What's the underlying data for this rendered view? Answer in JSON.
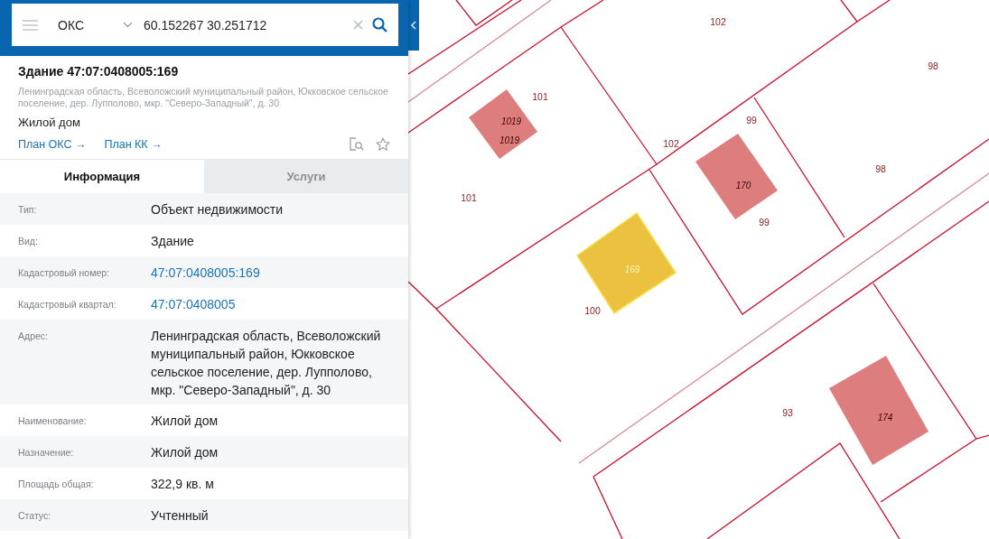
{
  "search": {
    "category": "ОКС",
    "query": "60.152267 30.251712"
  },
  "object": {
    "title": "Здание 47:07:0408005:169",
    "address": "Ленинградская область, Всеволожский муниципальный район, Юкковское сельское поселение, дер. Лупполово, мкр. \"Северо-Западный\", д. 30",
    "purpose": "Жилой дом",
    "links": [
      "План ОКС →",
      "План КК →"
    ]
  },
  "tabs": [
    {
      "label": "Информация",
      "selected": true
    },
    {
      "label": "Услуги",
      "selected": false
    }
  ],
  "fields": [
    {
      "label": "Тип:",
      "value": "Объект недвижимости",
      "kind": "text"
    },
    {
      "label": "Вид:",
      "value": "Здание",
      "kind": "text"
    },
    {
      "label": "Кадастровый номер:",
      "value": "47:07:0408005:169",
      "kind": "link"
    },
    {
      "label": "Кадастровый квартал:",
      "value": "47:07:0408005",
      "kind": "link"
    },
    {
      "label": "Адрес:",
      "value": "Ленинградская область, Всеволожский муниципальный район, Юкковское сельское поселение, дер. Лупполово, мкр. \"Северо-Западный\", д. 30",
      "kind": "text"
    },
    {
      "label": "Наименование:",
      "value": "Жилой дом",
      "kind": "text"
    },
    {
      "label": "Назначение:",
      "value": "Жилой дом",
      "kind": "text"
    },
    {
      "label": "Площадь общая:",
      "value": "322,9 кв. м",
      "kind": "text"
    },
    {
      "label": "Статус:",
      "value": "Учтенный",
      "kind": "text"
    }
  ],
  "map": {
    "parcels": [
      {
        "number": "102"
      },
      {
        "number": "98"
      },
      {
        "number": "101"
      },
      {
        "number": "99"
      },
      {
        "number": "102"
      },
      {
        "number": "98"
      },
      {
        "number": "101"
      },
      {
        "number": "99"
      },
      {
        "number": "100"
      },
      {
        "number": "93"
      }
    ],
    "buildings": [
      {
        "labels": [
          "1019",
          "1019"
        ],
        "selected": false
      },
      {
        "labels": [
          "170"
        ],
        "selected": false
      },
      {
        "labels": [
          "169"
        ],
        "selected": true
      },
      {
        "labels": [
          "174"
        ],
        "selected": false
      }
    ]
  }
}
